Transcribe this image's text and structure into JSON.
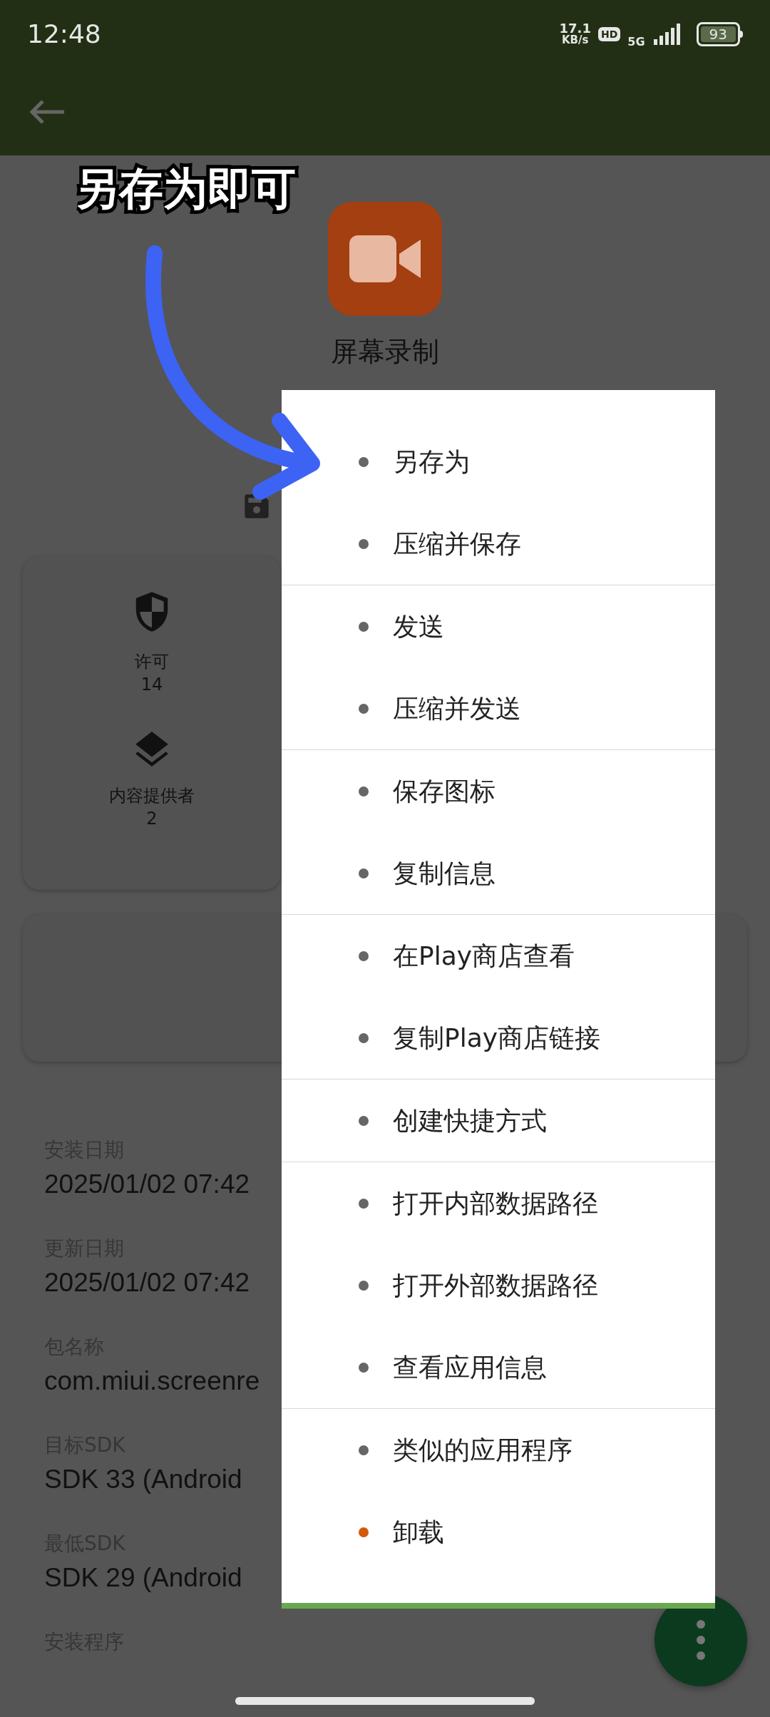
{
  "status_bar": {
    "time": "12:48",
    "speed": "17.1",
    "speed_unit": "KB/s",
    "hd": "HD",
    "network": "5G",
    "battery": "93"
  },
  "app": {
    "name": "屏幕录制"
  },
  "stats": [
    {
      "kind": "shield",
      "label": "许可",
      "count": "14"
    },
    {
      "kind": "layers",
      "label": "内容提供者",
      "count": "2"
    }
  ],
  "details": [
    {
      "label": "安装日期",
      "value": "2025/01/02 07:42"
    },
    {
      "label": "更新日期",
      "value": "2025/01/02 07:42"
    },
    {
      "label": "包名称",
      "value": "com.miui.screenre"
    },
    {
      "label": "目标SDK",
      "value": "SDK 33 (Android"
    },
    {
      "label": "最低SDK",
      "value": "SDK 29 (Android"
    },
    {
      "label": "安装程序"
    }
  ],
  "menu": {
    "groups": [
      {
        "items": [
          {
            "label": "另存为",
            "color": "#666666"
          },
          {
            "label": "压缩并保存",
            "color": "#666666"
          }
        ]
      },
      {
        "items": [
          {
            "label": "发送",
            "color": "#666666"
          },
          {
            "label": "压缩并发送",
            "color": "#666666"
          }
        ]
      },
      {
        "items": [
          {
            "label": "保存图标",
            "color": "#666666"
          },
          {
            "label": "复制信息",
            "color": "#666666"
          }
        ]
      },
      {
        "items": [
          {
            "label": "在Play商店查看",
            "color": "#666666"
          },
          {
            "label": "复制Play商店链接",
            "color": "#666666"
          }
        ]
      },
      {
        "items": [
          {
            "label": "创建快捷方式",
            "color": "#666666"
          }
        ]
      },
      {
        "items": [
          {
            "label": "打开内部数据路径",
            "color": "#666666"
          },
          {
            "label": "打开外部数据路径",
            "color": "#666666"
          },
          {
            "label": "查看应用信息",
            "color": "#666666"
          }
        ]
      },
      {
        "items": [
          {
            "label": "类似的应用程序",
            "color": "#666666"
          },
          {
            "label": "卸载",
            "color": "#d35a0a"
          }
        ]
      }
    ]
  },
  "annotation": {
    "text": "另存为即可"
  }
}
